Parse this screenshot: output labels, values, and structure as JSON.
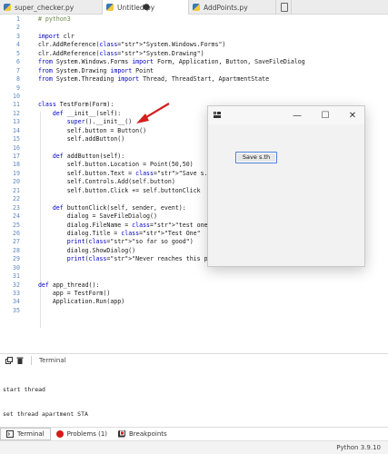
{
  "tabs": [
    {
      "label": "super_checker.py",
      "active": false
    },
    {
      "label": "Untitled.py",
      "active": true,
      "modified_marker": "●"
    },
    {
      "label": "AddPoints.py",
      "active": false
    }
  ],
  "editor": {
    "lines": [
      "  # python3",
      "",
      "  import clr",
      "  clr.AddReference(\"System.Windows.Forms\")",
      "  clr.AddReference(\"System.Drawing\")",
      "  from System.Windows.Forms import Form, Application, Button, SaveFileDialog",
      "  from System.Drawing import Point",
      "  from System.Threading import Thread, ThreadStart, ApartmentState",
      "",
      "",
      "  class TestForm(Form):",
      "      def __init__(self):",
      "          super().__init__()",
      "          self.button = Button()",
      "          self.addButton()",
      "",
      "      def addButton(self):",
      "          self.button.Location = Point(50,50)",
      "          self.button.Text = \"Save s.th\"",
      "          self.Controls.Add(self.button)",
      "          self.button.Click += self.buttonClick",
      "",
      "      def buttonClick(self, sender, event):",
      "          dialog = SaveFileDialog()",
      "          dialog.FileName = \"test one\"",
      "          dialog.Title = \"Test One\"",
      "          print(\"so far so good\")",
      "          dialog.ShowDialog()",
      "          print(\"Never reaches this point\")",
      "",
      "",
      "  def app_thread():",
      "      app = TestForm()",
      "      Application.Run(app)",
      ""
    ],
    "line_numbers": [
      "1",
      "2",
      "3",
      "4",
      "5",
      "6",
      "7",
      "8",
      "9",
      "10",
      "11",
      "12",
      "13",
      "14",
      "15",
      "16",
      "17",
      "18",
      "19",
      "20",
      "21",
      "22",
      "23",
      "24",
      "25",
      "26",
      "27",
      "28",
      "29",
      "30",
      "31",
      "32",
      "33",
      "34",
      "35"
    ]
  },
  "form_window": {
    "button_label": "Save s.th",
    "minimize": "—",
    "maximize": "☐",
    "close": "✕"
  },
  "terminal": {
    "tab_label": "Terminal",
    "output": [
      "start thread",
      "set thread apartment STA"
    ]
  },
  "bottom_tabs": [
    {
      "label": "Terminal",
      "active": true,
      "icon": "terminal-icon"
    },
    {
      "label": "Problems (1)",
      "active": false,
      "icon": "error-icon"
    },
    {
      "label": "Breakpoints",
      "active": false,
      "icon": "breakpoints-icon"
    }
  ],
  "status": {
    "python_version": "Python 3.9.10"
  },
  "colors": {
    "keyword": "#0000c8",
    "string": "#b0181a",
    "comment": "#6a8a4a",
    "line_number": "#5b8ac4",
    "arrow": "#d21f1f"
  }
}
